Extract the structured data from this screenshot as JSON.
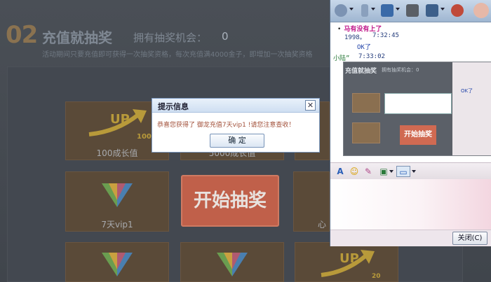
{
  "game": {
    "step_number": "02",
    "title": "充值就抽奖",
    "chances_label": "拥有抽奖机会：",
    "chances_count": "0",
    "rules": "活动期间只要充值即可获得一次抽奖资格，每次充值满4000金子，即增加一次抽奖资格",
    "prizes": [
      {
        "label": "100成长值",
        "icon": "up-100-icon",
        "icon_text": "UP",
        "icon_sub": "100"
      },
      {
        "label": "5000成长值",
        "icon": "gold-coins-icon"
      },
      {
        "label": "7天vip1",
        "icon": "vip-crystal-icon"
      },
      {
        "label": "心",
        "icon": "heart-icon"
      },
      {
        "label": "",
        "icon": "vip-crystal-icon"
      },
      {
        "label": "",
        "icon": "vip-crystal-icon"
      },
      {
        "label": "",
        "icon": "up-20-icon",
        "icon_text": "UP",
        "icon_sub": "20"
      }
    ],
    "start_button": "开始抽奖"
  },
  "dialog": {
    "title": "提示信息",
    "message": "恭喜您获得了 御龙充值7天vip1 !请您注意查收！",
    "ok_label": "确 定",
    "close_icon": "close-icon"
  },
  "chat": {
    "toolbar_icons": [
      "webcam-icon",
      "microphone-icon",
      "folder-icon",
      "screen-record-icon",
      "contacts-icon",
      "user-block-icon",
      "avatar-icon"
    ],
    "status_line": "马有没有上了",
    "messages": [
      {
        "sender": "1998。",
        "time": "7:32:45"
      },
      {
        "text": "OK了"
      },
      {
        "sender": "小陆”",
        "time": "7:33:02"
      }
    ],
    "screenshot_title": "充值就抽奖",
    "screenshot_sub": "拥有抽奖机会：0",
    "screenshot_start": "开始抽奖",
    "screenshot_side_text": "OK了",
    "format_icons": [
      "font-icon",
      "emoji-icon",
      "magic-face-icon",
      "image-icon",
      "screenshot-icon"
    ],
    "close_button": "关闭(C)"
  },
  "colors": {
    "chat_status": "#c0188a",
    "chat_text": "#223a7a",
    "dialog_message": "#a2503a",
    "start_button": "#c0604a"
  }
}
